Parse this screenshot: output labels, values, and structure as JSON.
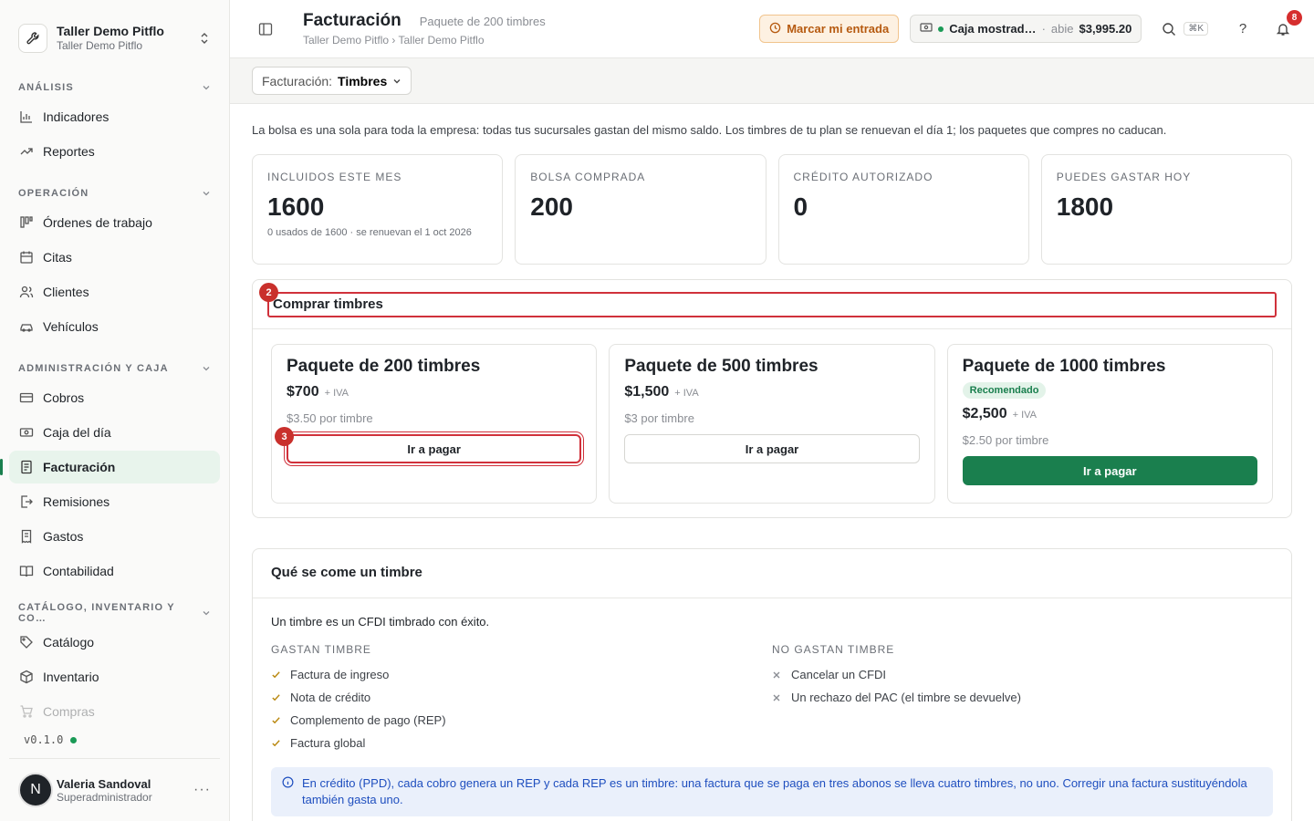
{
  "org": {
    "name": "Taller Demo Pitflo",
    "sub": "Taller Demo Pitflo"
  },
  "sidebar": {
    "sections": [
      {
        "label": "ANÁLISIS",
        "items": [
          {
            "label": "Indicadores",
            "icon": "bar-chart-icon"
          },
          {
            "label": "Reportes",
            "icon": "trend-icon"
          }
        ]
      },
      {
        "label": "OPERACIÓN",
        "items": [
          {
            "label": "Órdenes de trabajo",
            "icon": "kanban-icon"
          },
          {
            "label": "Citas",
            "icon": "calendar-icon"
          },
          {
            "label": "Clientes",
            "icon": "users-icon"
          },
          {
            "label": "Vehículos",
            "icon": "car-icon"
          }
        ]
      },
      {
        "label": "ADMINISTRACIÓN Y CAJA",
        "items": [
          {
            "label": "Cobros",
            "icon": "card-icon"
          },
          {
            "label": "Caja del día",
            "icon": "cash-icon"
          },
          {
            "label": "Facturación",
            "icon": "invoice-icon"
          },
          {
            "label": "Remisiones",
            "icon": "export-icon"
          },
          {
            "label": "Gastos",
            "icon": "receipt-icon"
          },
          {
            "label": "Contabilidad",
            "icon": "book-icon"
          }
        ]
      },
      {
        "label": "CATÁLOGO, INVENTARIO Y CO…",
        "items": [
          {
            "label": "Catálogo",
            "icon": "tag-icon"
          },
          {
            "label": "Inventario",
            "icon": "box-icon"
          },
          {
            "label": "Compras",
            "icon": "cart-icon"
          }
        ]
      }
    ],
    "version": "v0.1.0",
    "user": {
      "initial": "N",
      "name": "Valeria Sandoval",
      "role": "Superadministrador"
    }
  },
  "topbar": {
    "title": "Facturación",
    "subtitle": "Paquete de 200 timbres",
    "breadcrumb": "Taller Demo Pitflo › Taller Demo Pitflo",
    "entrada_label": "Marcar mi entrada",
    "caja_name": "Caja mostrad…",
    "caja_status": "abie",
    "caja_amount": "$3,995.20",
    "search_kbd": "⌘K",
    "help": "?",
    "notif_count": "8"
  },
  "filter": {
    "label": "Facturación:",
    "value": "Timbres"
  },
  "intro": "La bolsa es una sola para toda la empresa: todas tus sucursales gastan del mismo saldo. Los timbres de tu plan se renuevan el día 1; los paquetes que compres no caducan.",
  "stats": [
    {
      "label": "INCLUIDOS ESTE MES",
      "value": "1600",
      "note": "0 usados de 1600 · se renuevan el 1 oct 2026"
    },
    {
      "label": "BOLSA COMPRADA",
      "value": "200",
      "note": ""
    },
    {
      "label": "CRÉDITO AUTORIZADO",
      "value": "0",
      "note": ""
    },
    {
      "label": "PUEDES GASTAR HOY",
      "value": "1800",
      "note": ""
    }
  ],
  "buy": {
    "title": "Comprar timbres",
    "marker_title": "2",
    "marker_button": "3",
    "packages": [
      {
        "name": "Paquete de 200 timbres",
        "badge": "",
        "price": "$700",
        "iva": "+ IVA",
        "per": "$3.50 por timbre",
        "button": "Ir a pagar"
      },
      {
        "name": "Paquete de 500 timbres",
        "badge": "",
        "price": "$1,500",
        "iva": "+ IVA",
        "per": "$3 por timbre",
        "button": "Ir a pagar"
      },
      {
        "name": "Paquete de 1000 timbres",
        "badge": "Recomendado",
        "price": "$2,500",
        "iva": "+ IVA",
        "per": "$2.50 por timbre",
        "button": "Ir a pagar"
      }
    ]
  },
  "info": {
    "title": "Qué se come un timbre",
    "lead": "Un timbre es un CFDI timbrado con éxito.",
    "spend_title": "GASTAN TIMBRE",
    "spend": [
      "Factura de ingreso",
      "Nota de crédito",
      "Complemento de pago (REP)",
      "Factura global"
    ],
    "nospend_title": "NO GASTAN TIMBRE",
    "nospend": [
      "Cancelar un CFDI",
      "Un rechazo del PAC (el timbre se devuelve)"
    ],
    "callout": "En crédito (PPD), cada cobro genera un REP y cada REP es un timbre: una factura que se paga en tres abonos se lleva cuatro timbres, no uno. Corregir una factura sustituyéndola también gasta uno."
  },
  "colors": {
    "accent": "#1a7f4e",
    "marker": "#c9302c",
    "warning": "#b65a10",
    "info": "#1f4fbf"
  }
}
